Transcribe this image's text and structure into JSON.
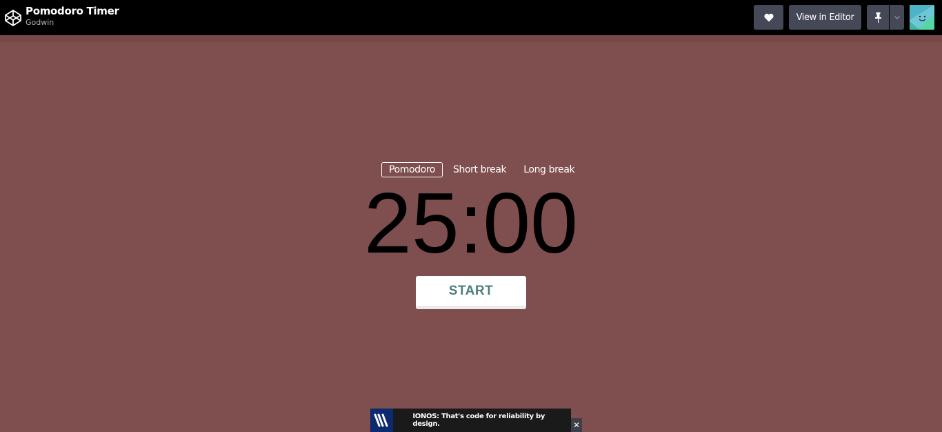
{
  "header": {
    "title": "Pomodoro Timer",
    "author": "Godwin",
    "view_in_editor_label": "View in Editor",
    "icons": [
      "codepen-logo-icon",
      "heart-icon",
      "pin-icon",
      "chevron-down-icon",
      "avatar"
    ]
  },
  "timer": {
    "tabs": [
      {
        "label": "Pomodoro",
        "active": true
      },
      {
        "label": "Short break",
        "active": false
      },
      {
        "label": "Long break",
        "active": false
      }
    ],
    "time": "25:00",
    "start_label": "START"
  },
  "ad": {
    "text": "IONOS: That's code for reliability by design.",
    "close_label": "✕"
  },
  "colors": {
    "background": "#7f4e4e",
    "topbar": "#000000",
    "button": "#444857",
    "start_text": "#4c7f7f"
  }
}
